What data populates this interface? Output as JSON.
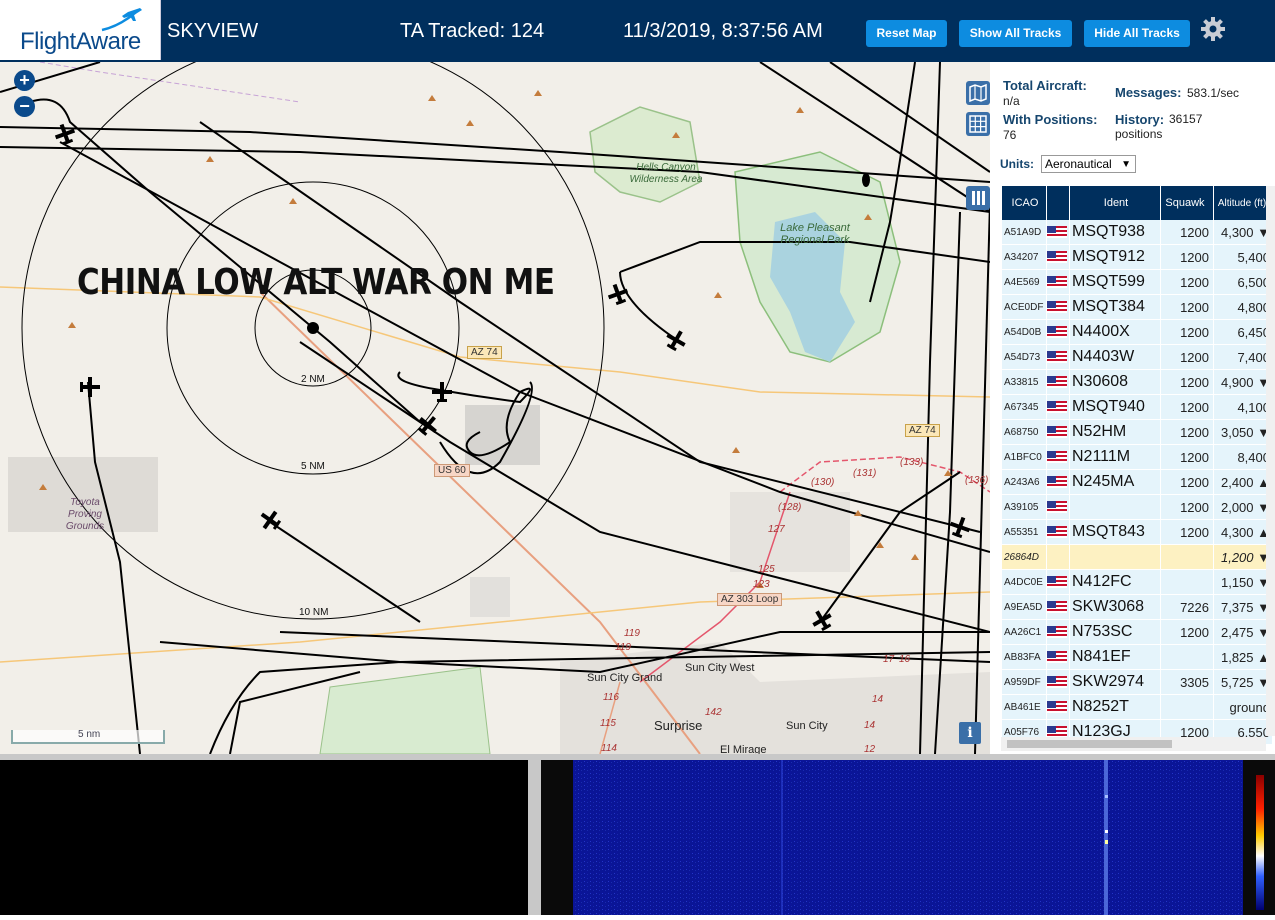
{
  "header": {
    "logo": "FlightAware",
    "site_name": "SKYVIEW",
    "tracked": "TA Tracked: 124",
    "clock": "11/3/2019, 8:37:56 AM",
    "buttons": {
      "reset": "Reset Map",
      "show_all": "Show All Tracks",
      "hide_all": "Hide All Tracks"
    }
  },
  "map": {
    "overlay_text": "CHINA LOW ALT WAR ON ME",
    "zoom_in": "+",
    "zoom_out": "−",
    "info": "i",
    "scale": "5 nm",
    "range_rings": [
      "2 NM",
      "5 NM",
      "10 NM"
    ],
    "labels": {
      "hells_canyon": "Hells Canyon Wilderness Area",
      "lake_pleasant": "Lake Pleasant Regional Park",
      "toyota": "Toyota Proving Grounds",
      "az74_a": "AZ 74",
      "az74_b": "AZ 74",
      "us60": "US 60",
      "az303": "AZ 303 Loop",
      "sun_city_grand": "Sun City Grand",
      "sun_city_west": "Sun City West",
      "surprise": "Surprise",
      "sun_city": "Sun City",
      "el_mirage": "El Mirage"
    },
    "road_numbers": [
      "(130)",
      "(131)",
      "(133)",
      "(136)",
      "(128)",
      "127",
      "125",
      "123",
      "119",
      "119",
      "116",
      "115",
      "114",
      "142",
      "17",
      "16",
      "14",
      "14",
      "12"
    ]
  },
  "stats": {
    "total_label": "Total Aircraft:",
    "total_value": "n/a",
    "positions_label": "With Positions:",
    "positions_value": "76",
    "messages_label": "Messages:",
    "messages_value": "583.1/sec",
    "history_label": "History:",
    "history_value": "36157 positions",
    "units_label": "Units:",
    "units_value": "Aeronautical"
  },
  "table": {
    "headers": {
      "icao": "ICAO",
      "ident": "Ident",
      "squawk": "Squawk",
      "altitude": "Altitude (ft)"
    },
    "rows": [
      {
        "icao": "A51A9D",
        "ident": "MSQT938",
        "squawk": "1200",
        "alt": "4,300 ▼"
      },
      {
        "icao": "A34207",
        "ident": "MSQT912",
        "squawk": "1200",
        "alt": "5,400"
      },
      {
        "icao": "A4E569",
        "ident": "MSQT599",
        "squawk": "1200",
        "alt": "6,500"
      },
      {
        "icao": "ACE0DF",
        "ident": "MSQT384",
        "squawk": "1200",
        "alt": "4,800"
      },
      {
        "icao": "A54D0B",
        "ident": "N4400X",
        "squawk": "1200",
        "alt": "6,450"
      },
      {
        "icao": "A54D73",
        "ident": "N4403W",
        "squawk": "1200",
        "alt": "7,400"
      },
      {
        "icao": "A33815",
        "ident": "N30608",
        "squawk": "1200",
        "alt": "4,900 ▼"
      },
      {
        "icao": "A67345",
        "ident": "MSQT940",
        "squawk": "1200",
        "alt": "4,100"
      },
      {
        "icao": "A68750",
        "ident": "N52HM",
        "squawk": "1200",
        "alt": "3,050 ▼"
      },
      {
        "icao": "A1BFC0",
        "ident": "N2111M",
        "squawk": "1200",
        "alt": "8,400"
      },
      {
        "icao": "A243A6",
        "ident": "N245MA",
        "squawk": "1200",
        "alt": "2,400 ▲"
      },
      {
        "icao": "A39105",
        "ident": "",
        "squawk": "1200",
        "alt": "2,000 ▼"
      },
      {
        "icao": "A55351",
        "ident": "MSQT843",
        "squawk": "1200",
        "alt": "4,300 ▲"
      },
      {
        "icao": "26864D",
        "ident": "",
        "squawk": "",
        "alt": "1,200 ▼",
        "highlight": true,
        "noflag": true
      },
      {
        "icao": "A4DC0E",
        "ident": "N412FC",
        "squawk": "",
        "alt": "1,150 ▼"
      },
      {
        "icao": "A9EA5D",
        "ident": "SKW3068",
        "squawk": "7226",
        "alt": "7,375 ▼"
      },
      {
        "icao": "AA26C1",
        "ident": "N753SC",
        "squawk": "1200",
        "alt": "2,475 ▼"
      },
      {
        "icao": "AB83FA",
        "ident": "N841EF",
        "squawk": "",
        "alt": "1,825 ▲"
      },
      {
        "icao": "A959DF",
        "ident": "SKW2974",
        "squawk": "3305",
        "alt": "5,725 ▼"
      },
      {
        "icao": "AB461E",
        "ident": "N8252T",
        "squawk": "",
        "alt": "ground"
      },
      {
        "icao": "A05F76",
        "ident": "N123GJ",
        "squawk": "1200",
        "alt": "6,550"
      }
    ]
  },
  "colors": {
    "header_bg": "#002f5d",
    "button_bg": "#0d8ce0",
    "row_bg": "#e5f4fb",
    "row_highlight": "#fdf1c2"
  }
}
